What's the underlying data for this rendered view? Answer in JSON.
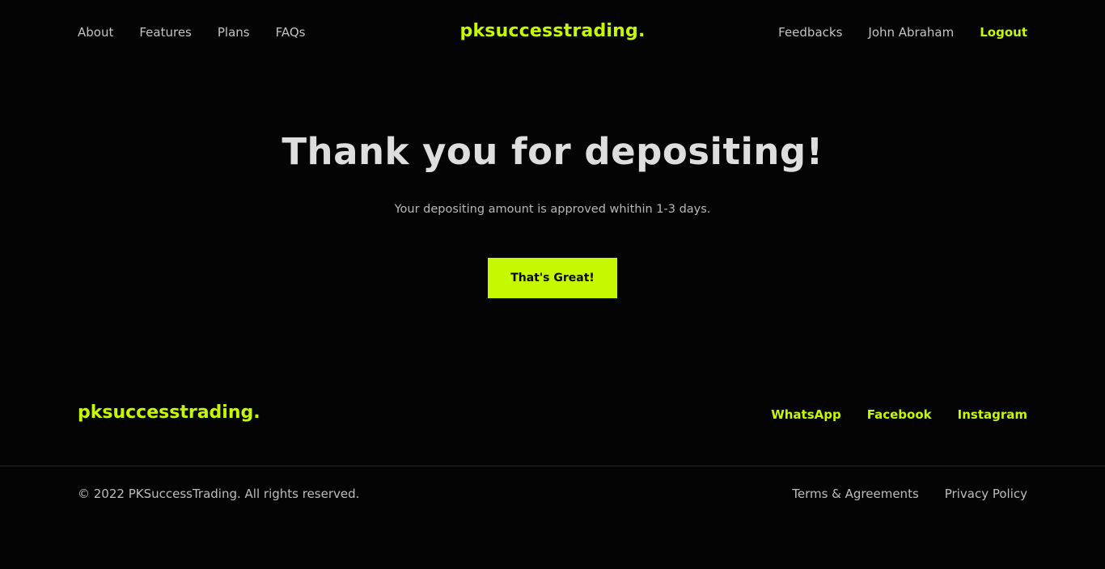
{
  "header": {
    "nav_left": [
      {
        "label": "About"
      },
      {
        "label": "Features"
      },
      {
        "label": "Plans"
      },
      {
        "label": "FAQs"
      }
    ],
    "brand": "pksuccesstrading.",
    "nav_right": {
      "feedbacks": "Feedbacks",
      "user_name": "John Abraham",
      "logout": "Logout"
    }
  },
  "main": {
    "title": "Thank you for depositing!",
    "subtitle": "Your depositing amount is approved whithin 1-3 days.",
    "cta_label": "That's Great!"
  },
  "footer": {
    "brand": "pksuccesstrading.",
    "social": [
      {
        "label": "WhatsApp"
      },
      {
        "label": "Facebook"
      },
      {
        "label": "Instagram"
      }
    ],
    "copyright": "© 2022 PKSuccessTrading. All rights reserved.",
    "legal": [
      {
        "label": "Terms & Agreements"
      },
      {
        "label": "Privacy Policy"
      }
    ]
  },
  "colors": {
    "background": "#040404",
    "accent": "#c6f800",
    "text_primary": "#dedede",
    "text_secondary": "#c4c4c4"
  }
}
